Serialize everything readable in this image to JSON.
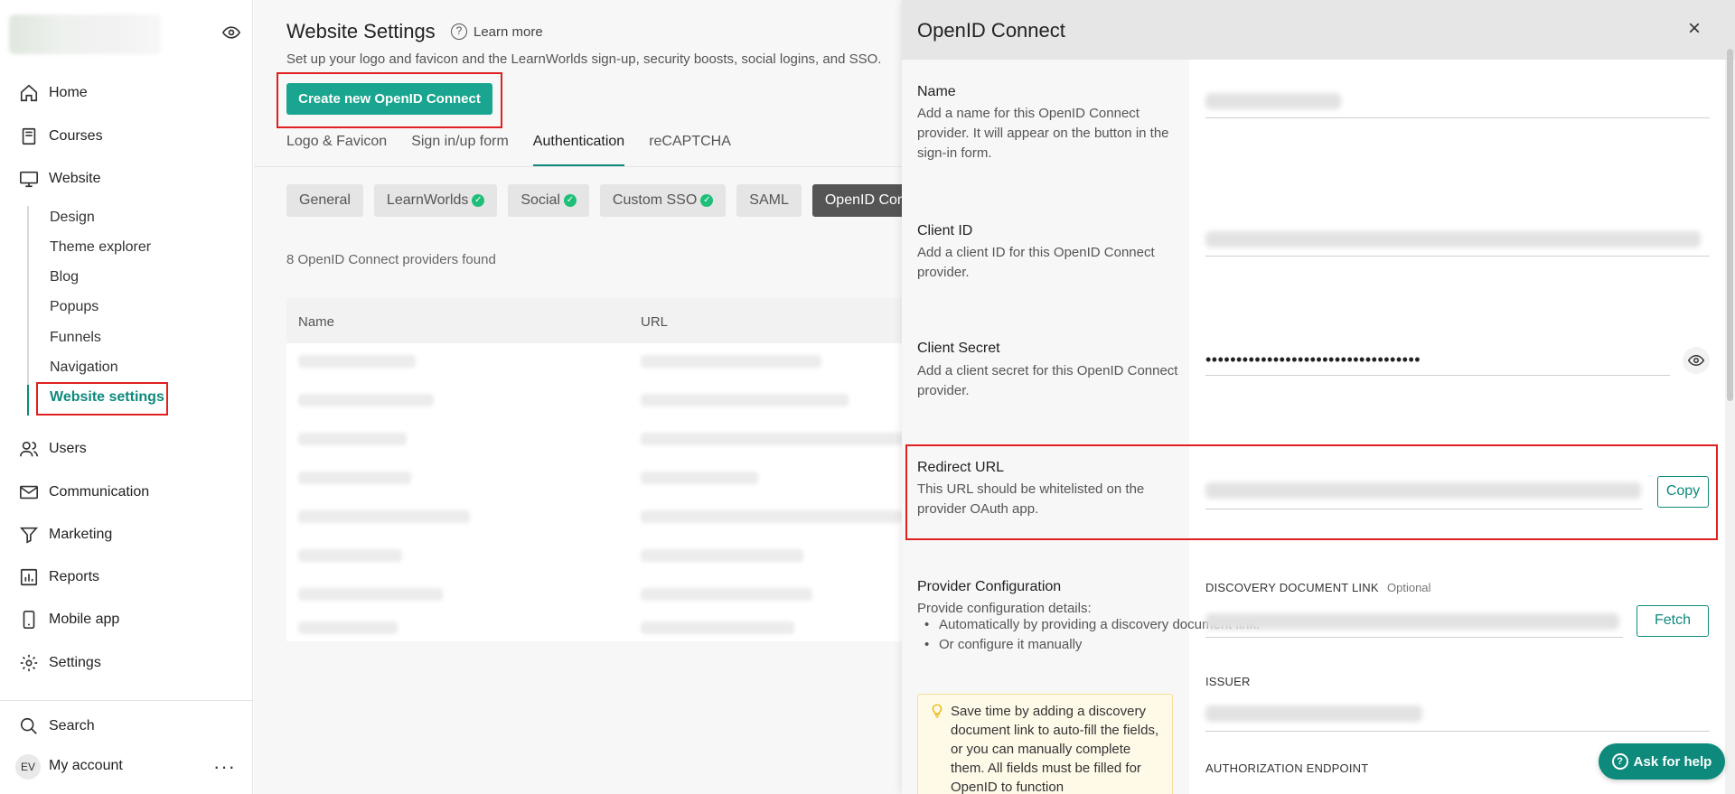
{
  "sidebar": {
    "home": "Home",
    "courses": "Courses",
    "website": "Website",
    "sub": [
      "Design",
      "Theme explorer",
      "Blog",
      "Popups",
      "Funnels",
      "Navigation",
      "Website settings"
    ],
    "users": "Users",
    "communication": "Communication",
    "marketing": "Marketing",
    "reports": "Reports",
    "mobile_app": "Mobile app",
    "settings": "Settings",
    "search": "Search",
    "avatar_initials": "EV",
    "my_account": "My account",
    "more": "···"
  },
  "main": {
    "title": "Website Settings",
    "help_glyph": "?",
    "learn_more": "Learn more",
    "subtitle": "Set up your logo and favicon and the LearnWorlds sign-up, security boosts, social logins, and SSO.",
    "create_button": "Create new OpenID Connect",
    "tabs": [
      "Logo & Favicon",
      "Sign in/up form",
      "Authentication",
      "reCAPTCHA"
    ],
    "pills": [
      {
        "label": "General",
        "check": false
      },
      {
        "label": "LearnWorlds",
        "check": true
      },
      {
        "label": "Social",
        "check": true
      },
      {
        "label": "Custom SSO",
        "check": true
      },
      {
        "label": "SAML",
        "check": false
      },
      {
        "label": "OpenID Connect",
        "check": false
      }
    ],
    "check_glyph": "✓",
    "found": "8 OpenID Connect providers found",
    "table_headers": {
      "name": "Name",
      "url": "URL"
    }
  },
  "panel": {
    "title": "OpenID Connect",
    "close": "×",
    "name": {
      "title": "Name",
      "desc": "Add a name for this OpenID Connect provider. It will appear on the button in the sign-in form."
    },
    "client_id": {
      "title": "Client ID",
      "desc": "Add a client ID for this OpenID Connect provider."
    },
    "client_secret": {
      "title": "Client Secret",
      "desc": "Add a client secret for this OpenID Connect provider.",
      "value": "•••••••••••••••••••••••••••••••••••"
    },
    "redirect": {
      "title": "Redirect URL",
      "desc": "This URL should be whitelisted on the provider OAuth app.",
      "copy": "Copy"
    },
    "provider": {
      "title": "Provider Configuration",
      "desc": "Provide configuration details:",
      "bullets": [
        "Automatically by providing a discovery document link.",
        "Or configure it manually"
      ],
      "tip": "Save time by adding a discovery document link to auto-fill the fields, or you can manually complete them. All fields must be filled for OpenID to function"
    },
    "discovery_label": "DISCOVERY DOCUMENT LINK",
    "optional": "Optional",
    "fetch": "Fetch",
    "issuer_label": "ISSUER",
    "auth_endpoint_label": "AUTHORIZATION ENDPOINT"
  },
  "ask_help": {
    "glyph": "?",
    "label": "Ask for help"
  },
  "colors": {
    "accent": "#0d8a7c",
    "highlight": "#e02020",
    "tip_bg": "#fff9e8"
  }
}
